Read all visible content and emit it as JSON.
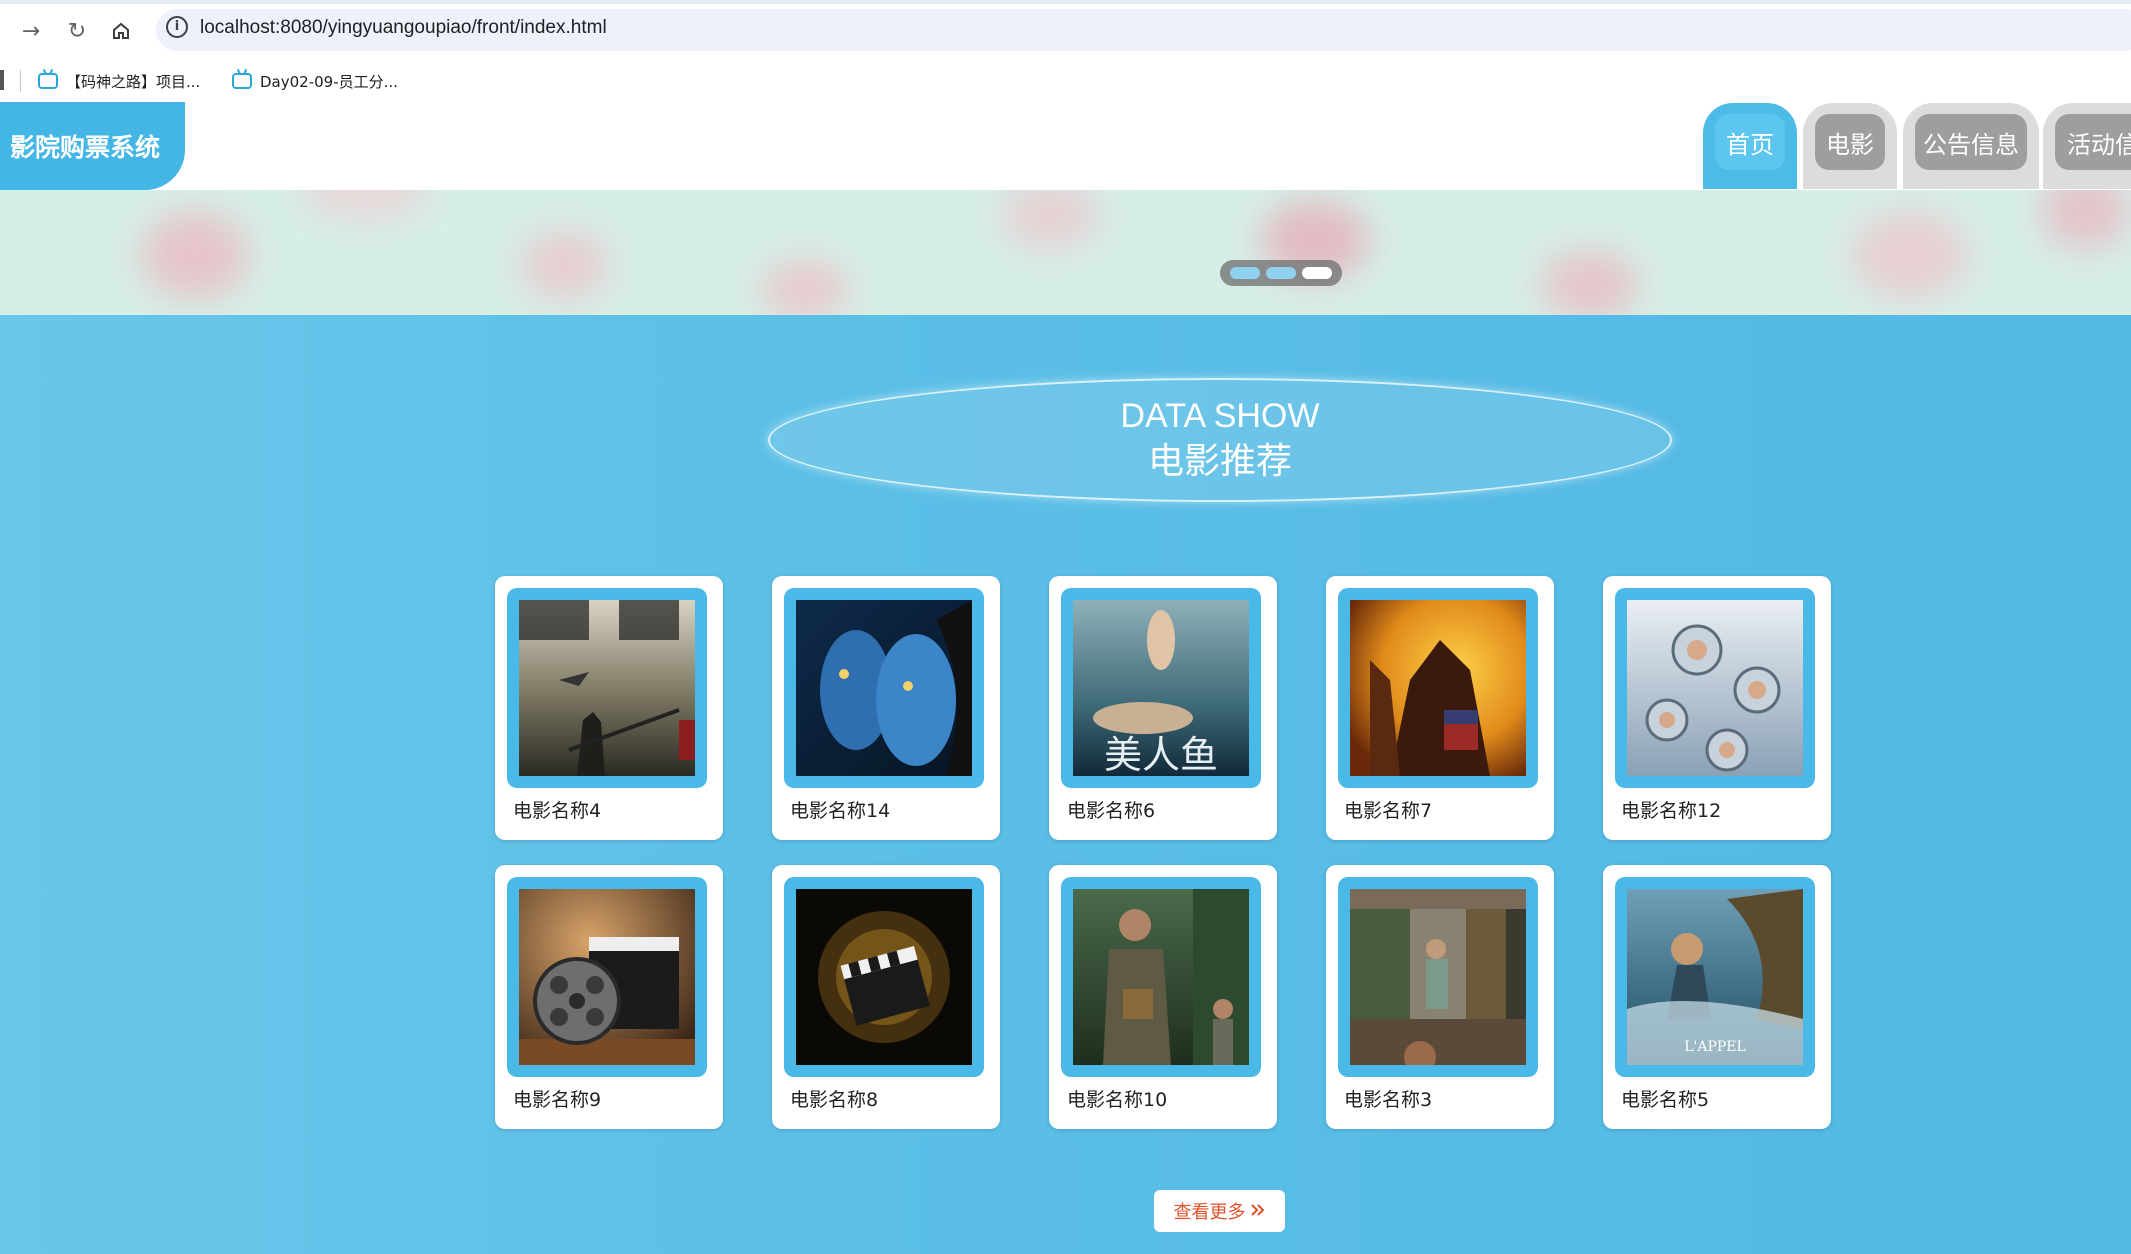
{
  "browser": {
    "url": "localhost:8080/yingyuangoupiao/front/index.html",
    "bookmarks": [
      {
        "label": "【码神之路】项目..."
      },
      {
        "label": "Day02-09-员工分..."
      }
    ]
  },
  "site": {
    "logo": "影院购票系统",
    "nav": [
      {
        "label": "首页",
        "active": true
      },
      {
        "label": "电影",
        "active": false
      },
      {
        "label": "公告信息",
        "active": false
      },
      {
        "label": "活动信"
      }
    ]
  },
  "section": {
    "title_en": "DATA SHOW",
    "title_cn": "电影推荐"
  },
  "movies": [
    {
      "name": "电影名称4"
    },
    {
      "name": "电影名称14"
    },
    {
      "name": "电影名称6"
    },
    {
      "name": "电影名称7"
    },
    {
      "name": "电影名称12"
    },
    {
      "name": "电影名称9"
    },
    {
      "name": "电影名称8"
    },
    {
      "name": "电影名称10"
    },
    {
      "name": "电影名称3"
    },
    {
      "name": "电影名称5"
    }
  ],
  "more_button": "查看更多"
}
